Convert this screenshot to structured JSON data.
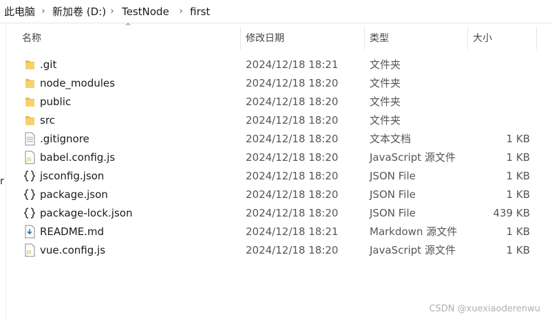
{
  "breadcrumb": [
    "此电脑",
    "新加卷 (D:)",
    "TestNode",
    "first"
  ],
  "columns": {
    "name": "名称",
    "date": "修改日期",
    "type": "类型",
    "size": "大小"
  },
  "files": [
    {
      "icon": "folder-icon",
      "name": ".git",
      "date": "2024/12/18 18:21",
      "type": "文件夹",
      "size": ""
    },
    {
      "icon": "folder-icon",
      "name": "node_modules",
      "date": "2024/12/18 18:20",
      "type": "文件夹",
      "size": ""
    },
    {
      "icon": "folder-icon",
      "name": "public",
      "date": "2024/12/18 18:20",
      "type": "文件夹",
      "size": ""
    },
    {
      "icon": "folder-icon",
      "name": "src",
      "date": "2024/12/18 18:20",
      "type": "文件夹",
      "size": ""
    },
    {
      "icon": "text-file-icon",
      "name": ".gitignore",
      "date": "2024/12/18 18:20",
      "type": "文本文档",
      "size": "1 KB"
    },
    {
      "icon": "js-file-icon",
      "name": "babel.config.js",
      "date": "2024/12/18 18:20",
      "type": "JavaScript 源文件",
      "size": "1 KB"
    },
    {
      "icon": "json-file-icon",
      "name": "jsconfig.json",
      "date": "2024/12/18 18:20",
      "type": "JSON File",
      "size": "1 KB"
    },
    {
      "icon": "json-file-icon",
      "name": "package.json",
      "date": "2024/12/18 18:20",
      "type": "JSON File",
      "size": "1 KB"
    },
    {
      "icon": "json-file-icon",
      "name": "package-lock.json",
      "date": "2024/12/18 18:20",
      "type": "JSON File",
      "size": "439 KB"
    },
    {
      "icon": "markdown-file-icon",
      "name": "README.md",
      "date": "2024/12/18 18:21",
      "type": "Markdown 源文件",
      "size": "1 KB"
    },
    {
      "icon": "js-file-icon",
      "name": "vue.config.js",
      "date": "2024/12/18 18:20",
      "type": "JavaScript 源文件",
      "size": "1 KB"
    }
  ],
  "left_pane_glyph": "r",
  "watermark": "CSDN @xuexiaoderenwu"
}
